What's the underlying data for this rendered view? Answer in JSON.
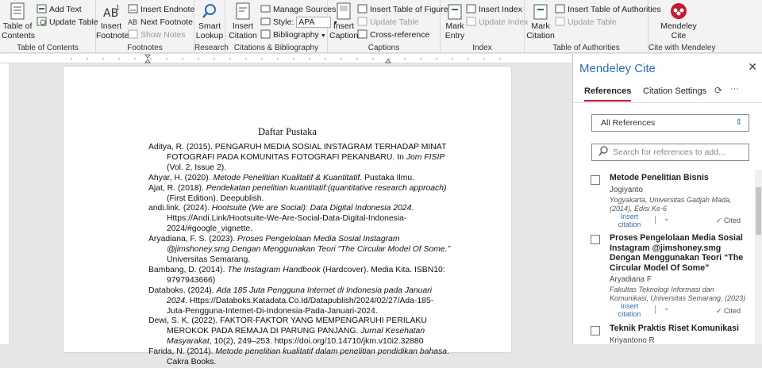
{
  "ribbon": {
    "toc": {
      "label": "Table of Contents",
      "add_text": "Add Text",
      "update_table": "Update Table",
      "group": "Table of Contents"
    },
    "footnotes": {
      "insert_footnote": "Insert Footnote",
      "insert_endnote": "Insert Endnote",
      "next_footnote": "Next Footnote",
      "show_notes": "Show Notes",
      "group": "Footnotes"
    },
    "research": {
      "smart_lookup": "Smart Lookup",
      "group": "Research"
    },
    "citations": {
      "insert_citation": "Insert Citation",
      "manage_sources": "Manage Sources",
      "style_label": "Style:",
      "style_value": "APA",
      "bibliography": "Bibliography",
      "group": "Citations & Bibliography"
    },
    "captions": {
      "insert_caption": "Insert Caption",
      "insert_tof": "Insert Table of Figures",
      "update_table": "Update Table",
      "cross_ref": "Cross-reference",
      "group": "Captions"
    },
    "index": {
      "mark_entry": "Mark Entry",
      "insert_index": "Insert Index",
      "update_index": "Update Index",
      "group": "Index"
    },
    "toa": {
      "mark_citation": "Mark Citation",
      "insert_toa": "Insert Table of Authorities",
      "update_table": "Update Table",
      "group": "Table of Authorities"
    },
    "mendeley": {
      "label": "Mendeley Cite",
      "group": "Cite with Mendeley"
    }
  },
  "document": {
    "title": "Daftar Pustaka",
    "refs": [
      {
        "a": "Aditya, R. (2015). PENGARUH MEDIA SOSIAL INSTAGRAM TERHADAP MINAT FOTOGRAFI PADA KOMUNITAS FOTOGRAFI PEKANBARU. In ",
        "i": "Jom FISIP",
        "b": " (Vol. 2, Issue 2)."
      },
      {
        "a": "Ahyar, H. (2020). ",
        "i": "Metode Penelitian Kualitatif & Kuantitatif",
        "b": ". Pustaka Ilmu."
      },
      {
        "a": "Ajat, R. (2018). ",
        "i": "Pendekatan penelitian kuantitatif:(quantitative research approach)",
        "b": " (First Edition). Deepublish."
      },
      {
        "a": "andi.link. (2024). ",
        "i": "Hootsuite (We are Social): Data Digital Indonesia 2024",
        "b": ". Https://Andi.Link/Hootsuite-We-Are-Social-Data-Digital-Indonesia-2024/#google_vignette."
      },
      {
        "a": "Aryadiana, F. S. (2023). ",
        "i": "Proses Pengelolaan Media Sosial Instagram @jimshoney.smg Dengan Menggunakan Teori “The Circular Model Of Some.”",
        "b": " Universitas Semarang."
      },
      {
        "a": "Bambang, D. (2014). ",
        "i": "The Instagram Handbook",
        "b": " (Hardcover). Media Kita. ISBN10: 9797943666)"
      },
      {
        "a": "Databoks. (2024). ",
        "i": "Ada 185 Juta Pengguna Internet di Indonesia pada Januari 2024",
        "b": ". Https://Databoks.Katadata.Co.Id/Datapublish/2024/02/27/Ada-185-Juta-Pengguna-Internet-Di-Indonesia-Pada-Januari-2024."
      },
      {
        "a": "Dewi, S. K. (2022). FAKTOR-FAKTOR YANG MEMPENGARUHI PERILAKU MEROKOK PADA REMAJA DI PARUNG PANJANG. ",
        "i": "Jurnal Kesehatan Masyarakat",
        "b": ", 10(2), 249–253. https://doi.org/10.14710/jkm.v10i2.32880"
      },
      {
        "a": "Farida, N. (2014). ",
        "i": "Metode penelitian kualitatif dalam penelitian pendidikan bahasa",
        "b": ". Cakra Books."
      }
    ]
  },
  "panel": {
    "title": "Mendeley Cite",
    "tab_refs": "References",
    "tab_settings": "Citation Settings",
    "filter": "All References",
    "search_placeholder": "Search for references to add...",
    "insert_citation": "Insert citation",
    "cited": "✓ Cited",
    "items": [
      {
        "title": "Metode Penelitian Bisnis",
        "author": "Jogiyanto",
        "pub": "Yogyakarta, Universitas Gadjah Mada, (2014), Edisi Ke-6"
      },
      {
        "title": "Proses Pengelolaan Media Sosial Instagram @jimshoney.smg Dengan Menggunakan Teori “The Circular Model Of Some”",
        "author": "Aryadiana F",
        "pub": "Fakultas Teknologi Informasi dan Komunikasi, Universitas Semarang, (2023)"
      },
      {
        "title": "Teknik Praktis Riset Komunikasi",
        "author": "Kriyantono R",
        "pub": ""
      }
    ]
  }
}
